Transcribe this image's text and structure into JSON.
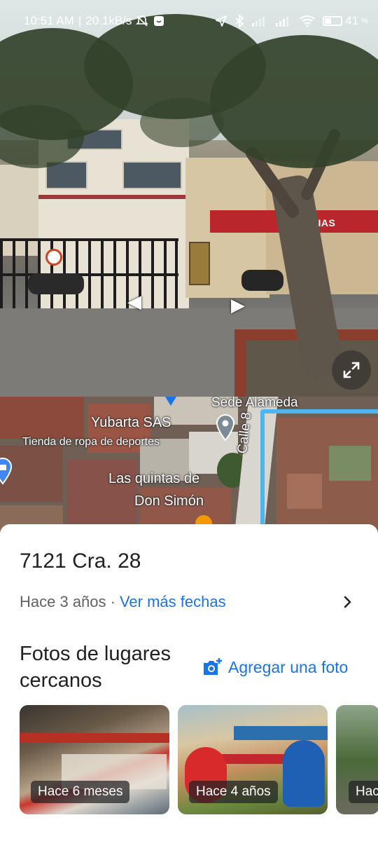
{
  "status_bar": {
    "time": "10:51 AM",
    "net_speed": "20.1kB/s",
    "battery": "41",
    "battery_level": 0.41
  },
  "map": {
    "labels": {
      "top": "Sede Alameda",
      "business": "Yubarta SAS",
      "business_sub": "Tienda de ropa de deportes",
      "place_line1": "Las quintas de",
      "place_line2": "Don Simón",
      "street": "Calle 8"
    }
  },
  "sheet": {
    "address": "7121 Cra. 28",
    "date_prefix": "Hace 3 años ·",
    "more_dates": "Ver más fechas",
    "nearby_title": "Fotos de lugares cercanos",
    "add_photo": "Agregar una foto",
    "photos": [
      {
        "badge": "Hace 6 meses"
      },
      {
        "badge": "Hace 4 años"
      },
      {
        "badge": "Hac"
      }
    ]
  },
  "colors": {
    "link": "#1a73e8",
    "route": "#4db5f0"
  },
  "icons": [
    "navigation-icon",
    "bluetooth-icon",
    "signal-icon",
    "wifi-icon",
    "battery-icon",
    "expand-icon",
    "add-photo-icon",
    "chevron-right-icon",
    "map-pin-icon",
    "shopping-pin-icon"
  ]
}
